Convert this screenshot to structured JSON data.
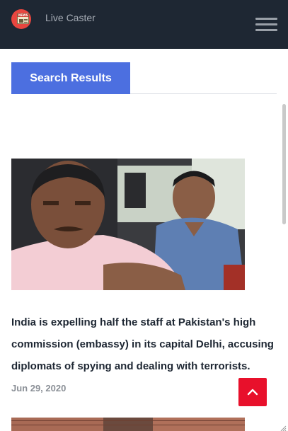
{
  "app": {
    "title": "Live Caster",
    "logo_icon": "newspaper-logo-icon",
    "logo_text": "NEWS"
  },
  "header": {
    "menu_icon": "hamburger-menu-icon",
    "background": "#1e2733"
  },
  "tabs": [
    {
      "label": "Search Results",
      "active": true
    }
  ],
  "articles": [
    {
      "image": "photo-man-in-pink-shirt-in-car",
      "title": "India is expelling half the staff at Pakistan's high commission (embassy) in its capital Delhi, accusing diplomats of spying and dealing with terrorists.",
      "date": "Jun 29, 2020"
    },
    {
      "image": "photo-shop-shutters-partially-visible"
    }
  ],
  "scroll_top_button": {
    "icon": "chevron-up-icon",
    "color": "#e8102b"
  },
  "colors": {
    "accent": "#4c6fe0",
    "title_text": "#1e2733",
    "date_text": "#8a8f96"
  }
}
